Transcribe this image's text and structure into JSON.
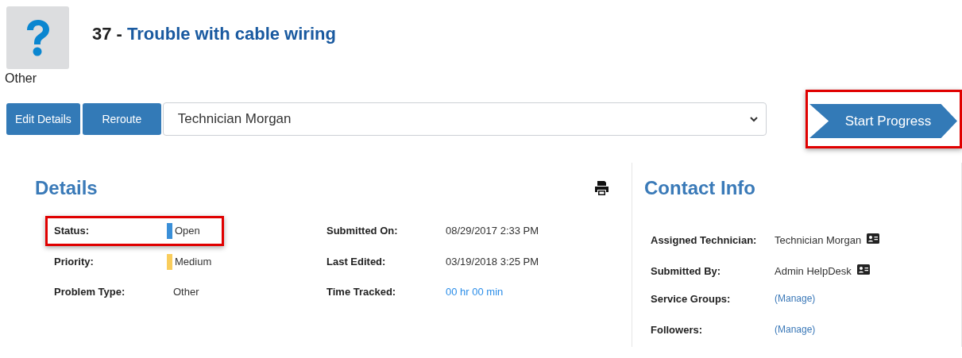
{
  "ticket": {
    "category": "Other",
    "number": "37",
    "separator": "-",
    "title": "Trouble with cable wiring"
  },
  "actions": {
    "buttons": [
      "Edit Details",
      "Reroute"
    ],
    "technician_select": {
      "value": "Technician Morgan"
    },
    "start_button": {
      "label": "Start Progress",
      "highlighted": true
    }
  },
  "details": {
    "heading": "Details",
    "fields": [
      {
        "label": "Status:",
        "value": "Open",
        "kind": "status",
        "color": "#3a8fd8",
        "highlighted": true
      },
      {
        "label": "Submitted On:",
        "value": "08/29/2017 2:33 PM",
        "kind": "text",
        "highlighted": false
      },
      {
        "label": "Priority:",
        "value": "Medium",
        "kind": "status",
        "color": "#f9cd5c",
        "highlighted": false
      },
      {
        "label": "Last Edited:",
        "value": "03/19/2018 3:25 PM",
        "kind": "text",
        "highlighted": false
      },
      {
        "label": "Problem Type:",
        "value": "Other",
        "kind": "text",
        "highlighted": false
      },
      {
        "label": "Time Tracked:",
        "value": "00 hr 00 min",
        "kind": "link",
        "highlighted": false
      }
    ]
  },
  "contact_info": {
    "heading": "Contact Info",
    "fields": [
      {
        "label": "Assigned Technician:",
        "value": "Technician Morgan",
        "kind": "person"
      },
      {
        "label": "Submitted By:",
        "value": "Admin HelpDesk",
        "kind": "person"
      },
      {
        "label": "Service Groups:",
        "value": "(Manage)",
        "kind": "link"
      },
      {
        "label": "Followers:",
        "value": "(Manage)",
        "kind": "link"
      }
    ]
  }
}
